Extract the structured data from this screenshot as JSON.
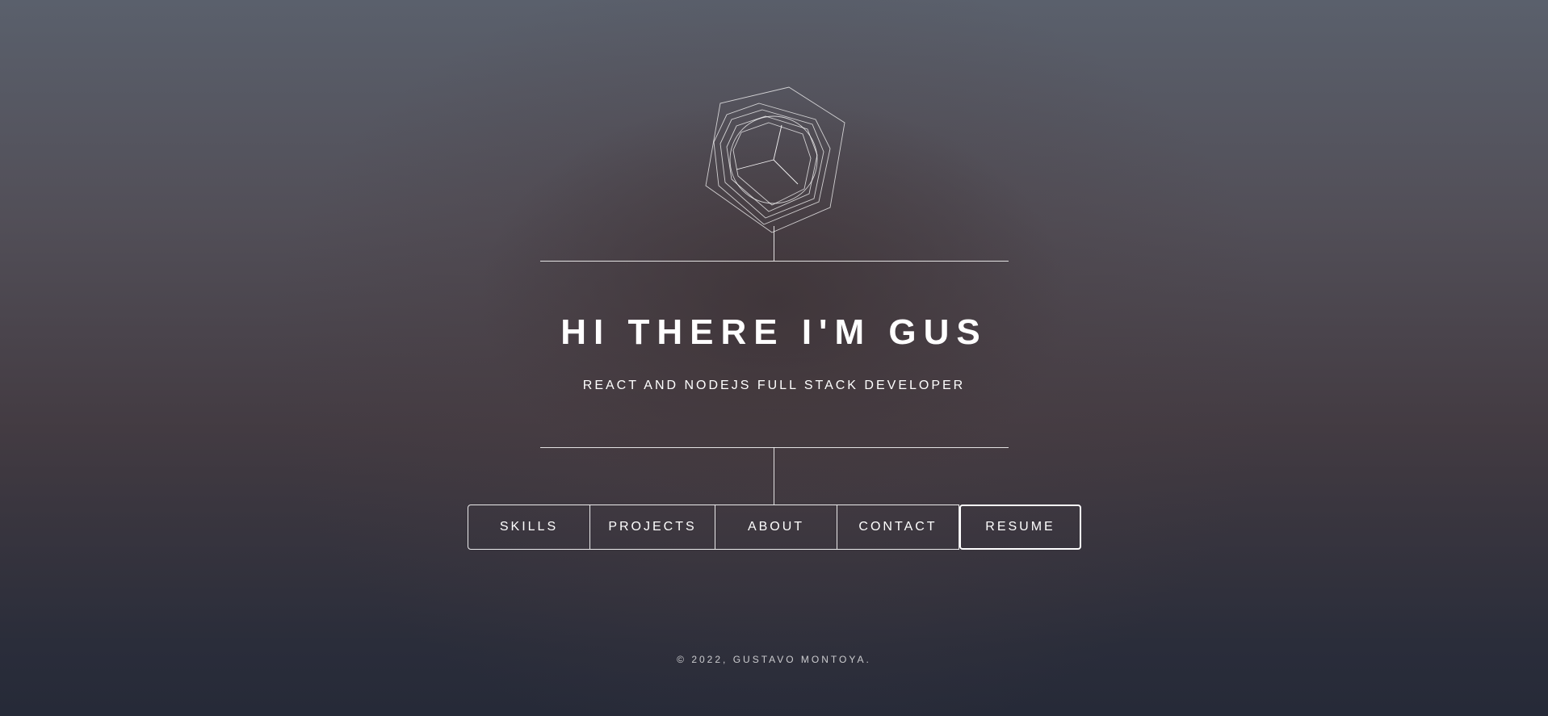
{
  "header": {
    "logo_icon": "hexagon-wireframe-logo-icon"
  },
  "intro": {
    "title": "HI THERE I'M GUS",
    "subtitle": "REACT AND NODEJS FULL STACK DEVELOPER"
  },
  "nav": {
    "items": [
      {
        "label": "SKILLS"
      },
      {
        "label": "PROJECTS"
      },
      {
        "label": "ABOUT"
      },
      {
        "label": "CONTACT"
      },
      {
        "label": "RESUME"
      }
    ]
  },
  "footer": {
    "text": "© 2022, GUSTAVO MONTOYA."
  },
  "colors": {
    "text": "#ffffff",
    "background_top": "#5a606c",
    "background_bottom": "#262a38"
  }
}
